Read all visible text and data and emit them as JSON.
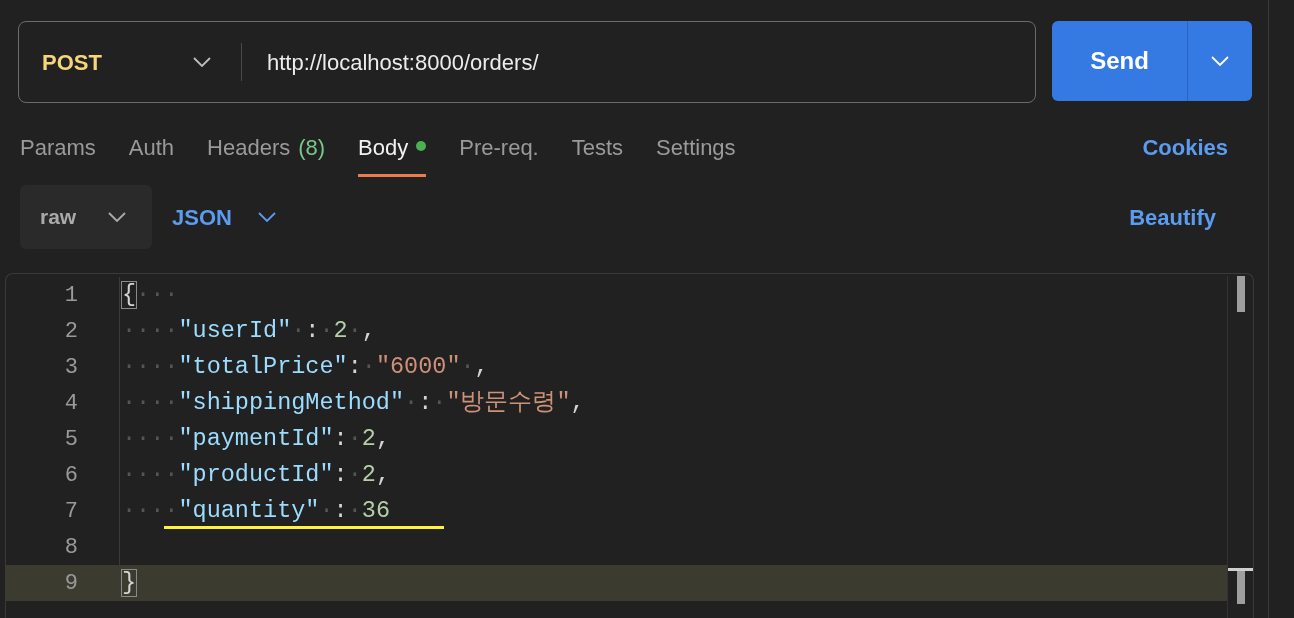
{
  "request": {
    "method": "POST",
    "url": "http://localhost:8000/orders/",
    "send": "Send"
  },
  "tabs": [
    {
      "label": "Params",
      "selected": false
    },
    {
      "label": "Auth",
      "selected": false
    },
    {
      "label": "Headers",
      "count": "(8)",
      "selected": false
    },
    {
      "label": "Body",
      "dot": true,
      "selected": true
    },
    {
      "label": "Pre-req.",
      "selected": false
    },
    {
      "label": "Tests",
      "selected": false
    },
    {
      "label": "Settings",
      "selected": false
    }
  ],
  "cookies": "Cookies",
  "body_mode": "raw",
  "body_format": "JSON",
  "beautify": "Beautify",
  "editor": {
    "lines": [
      {
        "number": "1",
        "current": false,
        "underlined": false,
        "tokens": [
          {
            "kind": "brace",
            "text": "{"
          },
          {
            "kind": "ws",
            "text": "···"
          }
        ]
      },
      {
        "number": "2",
        "current": false,
        "underlined": false,
        "tokens": [
          {
            "kind": "ws",
            "text": "····"
          },
          {
            "kind": "key",
            "text": "\"userId\""
          },
          {
            "kind": "ws",
            "text": "·"
          },
          {
            "kind": "punct",
            "text": ":"
          },
          {
            "kind": "ws",
            "text": "·"
          },
          {
            "kind": "num",
            "text": "2"
          },
          {
            "kind": "ws",
            "text": "·"
          },
          {
            "kind": "punct",
            "text": ","
          }
        ]
      },
      {
        "number": "3",
        "current": false,
        "underlined": false,
        "tokens": [
          {
            "kind": "ws",
            "text": "····"
          },
          {
            "kind": "key",
            "text": "\"totalPrice\""
          },
          {
            "kind": "punct",
            "text": ":"
          },
          {
            "kind": "ws",
            "text": "·"
          },
          {
            "kind": "str",
            "text": "\"6000\""
          },
          {
            "kind": "ws",
            "text": "·"
          },
          {
            "kind": "punct",
            "text": ","
          }
        ]
      },
      {
        "number": "4",
        "current": false,
        "underlined": false,
        "tokens": [
          {
            "kind": "ws",
            "text": "····"
          },
          {
            "kind": "key",
            "text": "\"shippingMethod\""
          },
          {
            "kind": "ws",
            "text": "·"
          },
          {
            "kind": "punct",
            "text": ":"
          },
          {
            "kind": "ws",
            "text": "·"
          },
          {
            "kind": "str",
            "text": "\"방문수령\""
          },
          {
            "kind": "punct",
            "text": ","
          }
        ]
      },
      {
        "number": "5",
        "current": false,
        "underlined": false,
        "tokens": [
          {
            "kind": "ws",
            "text": "····"
          },
          {
            "kind": "key",
            "text": "\"paymentId\""
          },
          {
            "kind": "punct",
            "text": ":"
          },
          {
            "kind": "ws",
            "text": "·"
          },
          {
            "kind": "num",
            "text": "2"
          },
          {
            "kind": "punct",
            "text": ","
          }
        ]
      },
      {
        "number": "6",
        "current": false,
        "underlined": false,
        "tokens": [
          {
            "kind": "ws",
            "text": "····"
          },
          {
            "kind": "key",
            "text": "\"productId\""
          },
          {
            "kind": "punct",
            "text": ":"
          },
          {
            "kind": "ws",
            "text": "·"
          },
          {
            "kind": "num",
            "text": "2"
          },
          {
            "kind": "punct",
            "text": ","
          }
        ]
      },
      {
        "number": "7",
        "current": false,
        "underlined": true,
        "tokens": [
          {
            "kind": "ws",
            "text": "····"
          },
          {
            "kind": "key",
            "text": "\"quantity\""
          },
          {
            "kind": "ws",
            "text": "·"
          },
          {
            "kind": "punct",
            "text": ":"
          },
          {
            "kind": "ws",
            "text": "·"
          },
          {
            "kind": "num",
            "text": "36"
          }
        ]
      },
      {
        "number": "8",
        "current": false,
        "underlined": false
      },
      {
        "number": "9",
        "current": true,
        "underlined": false,
        "tokens": [
          {
            "kind": "brace",
            "text": "}"
          }
        ]
      }
    ]
  }
}
